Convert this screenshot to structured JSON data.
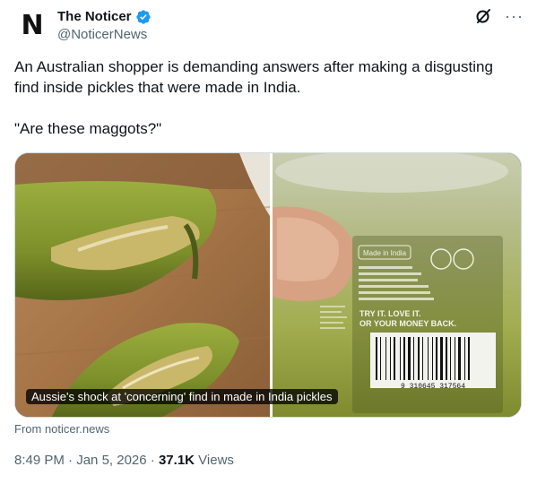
{
  "author": {
    "name": "The Noticer",
    "handle": "@NoticerNews",
    "avatar_letter": "N",
    "verified": true,
    "verified_color": "#1d9bf0"
  },
  "header_icons": [
    "grok-icon",
    "more-icon"
  ],
  "more_label": "···",
  "post": {
    "paragraph1": "An Australian shopper is demanding answers after making a disgusting find inside pickles that were made in India.",
    "paragraph2": "\"Are these maggots?\""
  },
  "media": {
    "caption": "Aussie's shock at 'concerning' find in made in India pickles",
    "label_text": {
      "made_in": "Made in India",
      "trademark": "Coles is a trade mark of Coles Group Limited used under licence by Coles Supermarkets Australia Pty Ltd 800 Toorak Road, Hawthorn East, Vic 3123. Call 1800 061 562 www.coles.com.au",
      "slogan1": "TRY IT. LOVE IT.",
      "slogan2": "OR YOUR MONEY BACK.",
      "barcode": "9 310645 317564"
    }
  },
  "source_label": "From noticer.news",
  "meta": {
    "time": "8:49 PM",
    "sep1": " · ",
    "date": "Jan 5, 2026",
    "sep2": " · ",
    "views_count": "37.1K",
    "views_label": " Views"
  }
}
